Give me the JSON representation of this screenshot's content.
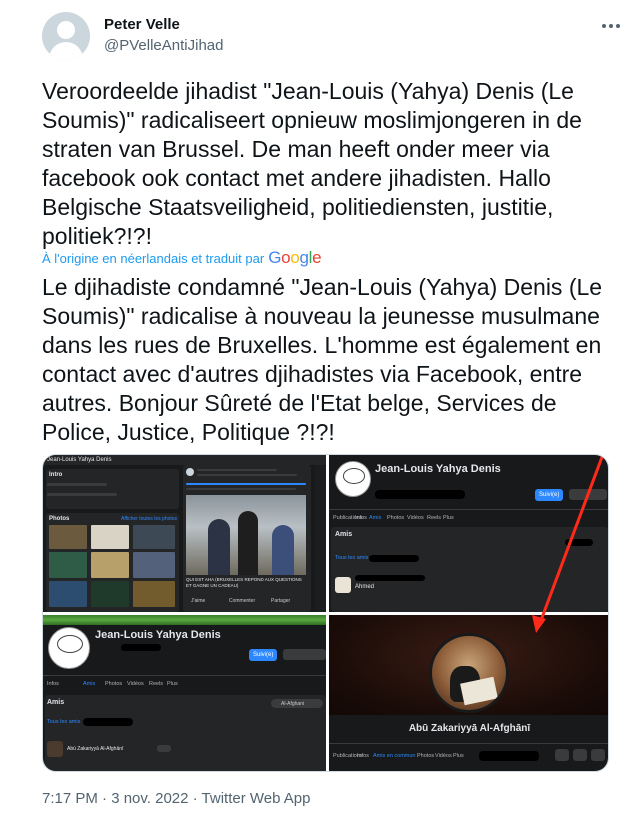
{
  "author": {
    "display_name": "Peter Velle",
    "handle": "@PVelleAntiJihad"
  },
  "tweet": {
    "original_lines": [
      "Veroordeelde jihadist \"Jean-Louis (Yahya) Denis (Le",
      "Soumis)\" radicaliseert opnieuw moslimjongeren in de",
      "straten van Brussel. De man heeft onder meer via",
      "facebook ook contact met andere jihadisten. Hallo",
      "Belgische Staatsveiligheid, politiediensten, justitie,",
      "politiek?!?!"
    ],
    "translation_note": "À l'origine en néerlandais et traduit par",
    "translator": "Google",
    "translated_lines": [
      "Le djihadiste condamné \"Jean-Louis (Yahya) Denis (Le",
      "Soumis)\" radicalise à nouveau la jeunesse musulmane",
      "dans les rues de Bruxelles. L'homme est également en",
      "contact avec d'autres djihadistes via Facebook, entre",
      "autres. Bonjour Sûreté de l'Etat belge, Services de",
      "Police, Justice, Politique ?!?!"
    ]
  },
  "media": {
    "img1": {
      "page_name": "Jean-Louis Yahya Denis",
      "intro": "Intro",
      "photos": "Photos",
      "see_all_photos": "Afficher toutes les photos",
      "post_caption": "QUI EST AHA (BRUXELLES REPOND AUX QUESTIONS ET GAGNE UN CADEAU)",
      "like": "J'aime",
      "comment": "Commenter",
      "share": "Partager"
    },
    "img2": {
      "profile_name": "Jean-Louis Yahya Denis",
      "follow_button": "Suivi(e)",
      "tabs": [
        "Publications",
        "Infos",
        "Amis",
        "Photos",
        "Vidéos",
        "Reels",
        "Plus"
      ],
      "friends_heading": "Amis",
      "all_friends": "Tous les amis",
      "friend_name": "Ahmed"
    },
    "img3": {
      "profile_name": "Jean-Louis Yahya Denis",
      "follow_button": "Suivi(e)",
      "tabs": [
        "Publications",
        "Infos",
        "Amis",
        "Photos",
        "Vidéos",
        "Reels",
        "Plus"
      ],
      "search_text": "Al-Afghani",
      "friends_heading": "Amis",
      "all_friends": "Tous les amis",
      "friend_name": "Abū Zakariyyā Al-Afghānī"
    },
    "img4": {
      "profile_name": "Abū Zakariyyā Al-Afghānī",
      "tabs": [
        "Publications",
        "Infos",
        "Amis en commun",
        "Photos",
        "Vidéos",
        "Plus"
      ]
    }
  },
  "footer": {
    "timestamp": "7:17 PM · 3 nov. 2022 · Twitter Web App"
  },
  "colors": {
    "link": "#1d9bf0",
    "muted": "#536471",
    "text": "#0f1419",
    "arrow": "#ff2a1a"
  }
}
